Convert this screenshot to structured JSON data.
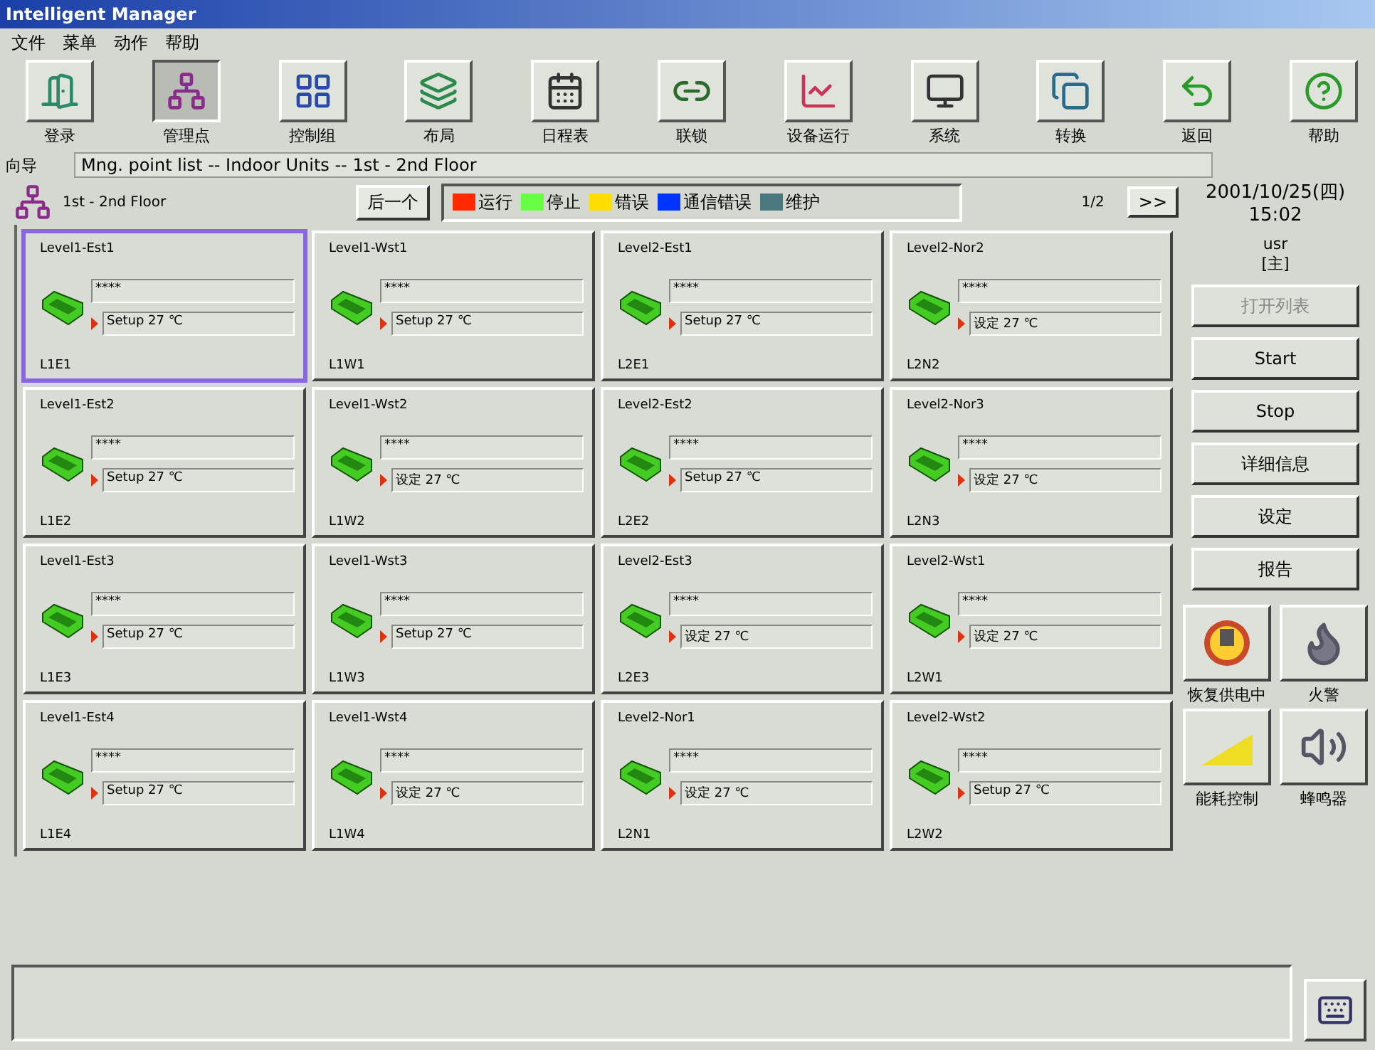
{
  "window": {
    "title": "Intelligent Manager"
  },
  "menu": [
    "文件",
    "菜单",
    "动作",
    "帮助"
  ],
  "toolbar": [
    {
      "label": "登录",
      "pressed": false
    },
    {
      "label": "管理点",
      "pressed": true
    },
    {
      "label": "控制组",
      "pressed": false
    },
    {
      "label": "布局",
      "pressed": false
    },
    {
      "label": "日程表",
      "pressed": false
    },
    {
      "label": "联锁",
      "pressed": false
    },
    {
      "label": "设备运行",
      "pressed": false
    },
    {
      "label": "系统",
      "pressed": false
    },
    {
      "label": "转换",
      "pressed": false
    },
    {
      "label": "返回",
      "pressed": false
    },
    {
      "label": "帮助",
      "pressed": false
    }
  ],
  "breadcrumb": {
    "label": "向导",
    "path": "Mng. point list -- Indoor Units -- 1st - 2nd Floor"
  },
  "floor": {
    "name": "1st - 2nd Floor",
    "next_button": "后一个",
    "page": "1/2",
    "more_button": ">>"
  },
  "legend": [
    {
      "label": "运行",
      "color": "#ff2a00"
    },
    {
      "label": "停止",
      "color": "#66ff44"
    },
    {
      "label": "错误",
      "color": "#ffdd00"
    },
    {
      "label": "通信错误",
      "color": "#0033ff"
    },
    {
      "label": "维护",
      "color": "#4a7a80"
    }
  ],
  "units": [
    {
      "name": "Level1-Est1",
      "value": "****",
      "setting": "Setup 27 ℃",
      "code": "L1E1",
      "selected": true
    },
    {
      "name": "Level1-Wst1",
      "value": "****",
      "setting": "Setup 27 ℃",
      "code": "L1W1",
      "selected": false
    },
    {
      "name": "Level2-Est1",
      "value": "****",
      "setting": "Setup 27 ℃",
      "code": "L2E1",
      "selected": false
    },
    {
      "name": "Level2-Nor2",
      "value": "****",
      "setting": "设定 27 ℃",
      "code": "L2N2",
      "selected": false
    },
    {
      "name": "Level1-Est2",
      "value": "****",
      "setting": "Setup 27 ℃",
      "code": "L1E2",
      "selected": false
    },
    {
      "name": "Level1-Wst2",
      "value": "****",
      "setting": "设定 27 ℃",
      "code": "L1W2",
      "selected": false
    },
    {
      "name": "Level2-Est2",
      "value": "****",
      "setting": "Setup 27 ℃",
      "code": "L2E2",
      "selected": false
    },
    {
      "name": "Level2-Nor3",
      "value": "****",
      "setting": "设定 27 ℃",
      "code": "L2N3",
      "selected": false
    },
    {
      "name": "Level1-Est3",
      "value": "****",
      "setting": "Setup 27 ℃",
      "code": "L1E3",
      "selected": false
    },
    {
      "name": "Level1-Wst3",
      "value": "****",
      "setting": "Setup 27 ℃",
      "code": "L1W3",
      "selected": false
    },
    {
      "name": "Level2-Est3",
      "value": "****",
      "setting": "设定 27 ℃",
      "code": "L2E3",
      "selected": false
    },
    {
      "name": "Level2-Wst1",
      "value": "****",
      "setting": "设定 27 ℃",
      "code": "L2W1",
      "selected": false
    },
    {
      "name": "Level1-Est4",
      "value": "****",
      "setting": "Setup 27 ℃",
      "code": "L1E4",
      "selected": false
    },
    {
      "name": "Level1-Wst4",
      "value": "****",
      "setting": "设定 27 ℃",
      "code": "L1W4",
      "selected": false
    },
    {
      "name": "Level2-Nor1",
      "value": "****",
      "setting": "设定 27 ℃",
      "code": "L2N1",
      "selected": false
    },
    {
      "name": "Level2-Wst2",
      "value": "****",
      "setting": "Setup 27 ℃",
      "code": "L2W2",
      "selected": false
    }
  ],
  "side": {
    "date": "2001/10/25(四)",
    "time": "15:02",
    "user": "usr",
    "role": "[主]",
    "buttons": [
      {
        "label": "打开列表",
        "disabled": true
      },
      {
        "label": "Start",
        "disabled": false
      },
      {
        "label": "Stop",
        "disabled": false
      },
      {
        "label": "详细信息",
        "disabled": false
      },
      {
        "label": "设定",
        "disabled": false
      },
      {
        "label": "报告",
        "disabled": false
      }
    ],
    "icon_buttons": [
      "恢复供电中",
      "火警",
      "能耗控制",
      "蜂鸣器"
    ]
  }
}
